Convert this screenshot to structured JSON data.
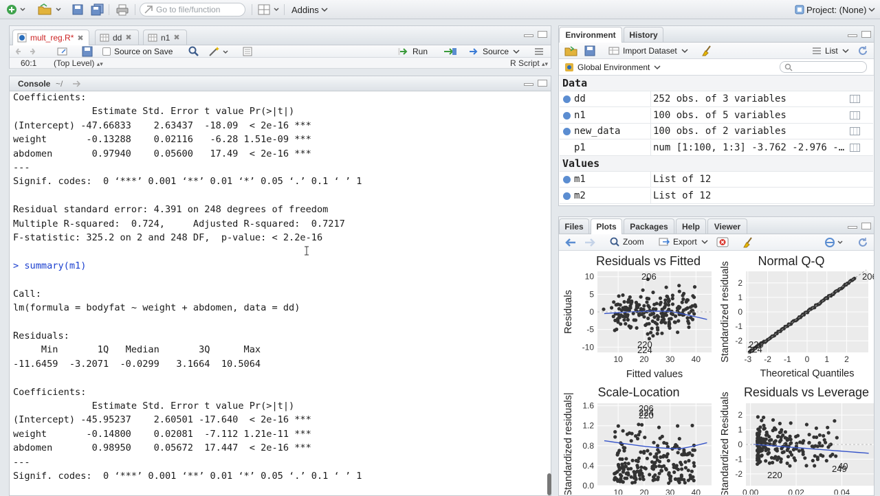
{
  "toolbar": {
    "goto_placeholder": "Go to file/function",
    "addins_label": "Addins",
    "project_label": "Project: (None)"
  },
  "source_pane": {
    "tabs": [
      {
        "label": "mult_reg.R*",
        "active": true
      },
      {
        "label": "dd",
        "active": false
      },
      {
        "label": "n1",
        "active": false
      }
    ],
    "source_on_save_label": "Source on Save",
    "run_label": "Run",
    "source_label": "Source",
    "cursor_pos": "60:1",
    "scope_label": "(Top Level)",
    "file_type": "R Script"
  },
  "console": {
    "title": "Console",
    "path": "~/",
    "lines": [
      {
        "text": "Coefficients:",
        "cmd": false
      },
      {
        "text": "              Estimate Std. Error t value Pr(>|t|)    ",
        "cmd": false
      },
      {
        "text": "(Intercept) -47.66833    2.63437  -18.09  < 2e-16 ***",
        "cmd": false
      },
      {
        "text": "weight       -0.13288    0.02116   -6.28 1.51e-09 ***",
        "cmd": false
      },
      {
        "text": "abdomen       0.97940    0.05600   17.49  < 2e-16 ***",
        "cmd": false
      },
      {
        "text": "---",
        "cmd": false
      },
      {
        "text": "Signif. codes:  0 ‘***’ 0.001 ‘**’ 0.01 ‘*’ 0.05 ‘.’ 0.1 ‘ ’ 1",
        "cmd": false
      },
      {
        "text": "",
        "cmd": false
      },
      {
        "text": "Residual standard error: 4.391 on 248 degrees of freedom",
        "cmd": false
      },
      {
        "text": "Multiple R-squared:  0.724,\tAdjusted R-squared:  0.7217 ",
        "cmd": false
      },
      {
        "text": "F-statistic: 325.2 on 2 and 248 DF,  p-value: < 2.2e-16",
        "cmd": false
      },
      {
        "text": "",
        "cmd": false
      },
      {
        "text": "> summary(m1)",
        "cmd": true
      },
      {
        "text": "",
        "cmd": false
      },
      {
        "text": "Call:",
        "cmd": false
      },
      {
        "text": "lm(formula = bodyfat ~ weight + abdomen, data = dd)",
        "cmd": false
      },
      {
        "text": "",
        "cmd": false
      },
      {
        "text": "Residuals:",
        "cmd": false
      },
      {
        "text": "     Min       1Q   Median       3Q      Max ",
        "cmd": false
      },
      {
        "text": "-11.6459  -3.2071  -0.0299   3.1664  10.5064 ",
        "cmd": false
      },
      {
        "text": "",
        "cmd": false
      },
      {
        "text": "Coefficients:",
        "cmd": false
      },
      {
        "text": "              Estimate Std. Error t value Pr(>|t|)    ",
        "cmd": false
      },
      {
        "text": "(Intercept) -45.95237    2.60501 -17.640  < 2e-16 ***",
        "cmd": false
      },
      {
        "text": "weight       -0.14800    0.02081  -7.112 1.21e-11 ***",
        "cmd": false
      },
      {
        "text": "abdomen       0.98950    0.05672  17.447  < 2e-16 ***",
        "cmd": false
      },
      {
        "text": "---",
        "cmd": false
      },
      {
        "text": "Signif. codes:  0 ‘***’ 0.001 ‘**’ 0.01 ‘*’ 0.05 ‘.’ 0.1 ‘ ’ 1",
        "cmd": false
      }
    ]
  },
  "env_pane": {
    "tabs": [
      {
        "label": "Environment",
        "active": true
      },
      {
        "label": "History",
        "active": false
      }
    ],
    "import_label": "Import Dataset",
    "list_label": "List",
    "scope_label": "Global Environment",
    "data_heading": "Data",
    "values_heading": "Values",
    "data": [
      {
        "name": "dd",
        "value": "252 obs. of 3 variables",
        "expand": true
      },
      {
        "name": "n1",
        "value": "100 obs. of 5 variables",
        "expand": true
      },
      {
        "name": "new_data",
        "value": "100 obs. of 2 variables",
        "expand": true
      },
      {
        "name": "p1",
        "value": "num [1:100, 1:3] -3.762 -2.976 -…",
        "expand": false
      }
    ],
    "values": [
      {
        "name": "m1",
        "value": "List of 12"
      },
      {
        "name": "m2",
        "value": "List of 12"
      }
    ]
  },
  "plots_pane": {
    "tabs": [
      {
        "label": "Files",
        "active": false
      },
      {
        "label": "Plots",
        "active": true
      },
      {
        "label": "Packages",
        "active": false
      },
      {
        "label": "Help",
        "active": false
      },
      {
        "label": "Viewer",
        "active": false
      }
    ],
    "zoom_label": "Zoom",
    "export_label": "Export"
  },
  "chart_data": [
    {
      "type": "scatter",
      "title": "Residuals vs Fitted",
      "xlabel": "Fitted values",
      "ylabel": "Residuals",
      "xlim": [
        2,
        46
      ],
      "ylim": [
        -11.5,
        11.5
      ],
      "xticks": [
        "10",
        "20",
        "30",
        "40"
      ],
      "yticks": [
        "10",
        "5",
        "0",
        "-5",
        "-10"
      ],
      "point_labels": [
        "206",
        "220",
        "224"
      ],
      "grid": true,
      "smooth_line": true
    },
    {
      "type": "scatter",
      "title": "Normal Q-Q",
      "xlabel": "Theoretical Quantiles",
      "ylabel": "Standardized residuals",
      "xlim": [
        -3.1,
        3.1
      ],
      "ylim": [
        -2.8,
        2.8
      ],
      "xticks": [
        "-3",
        "-2",
        "-1",
        "0",
        "1",
        "2"
      ],
      "yticks": [
        "2",
        "1",
        "0",
        "-1",
        "-2"
      ],
      "point_labels": [
        "206",
        "220",
        "224"
      ],
      "grid": true
    },
    {
      "type": "scatter",
      "title": "Scale-Location",
      "xlabel": "",
      "ylabel": "Standardized residuals|",
      "xlim": [
        2,
        46
      ],
      "ylim": [
        0,
        1.65
      ],
      "xticks": [
        "10",
        "20",
        "30",
        "40"
      ],
      "yticks": [
        "1.6",
        "1.2",
        "0.8",
        "0.4",
        "0.0"
      ],
      "point_labels": [
        "206",
        "224",
        "220"
      ],
      "grid": true,
      "smooth_line": true
    },
    {
      "type": "scatter",
      "title": "Residuals vs Leverage",
      "xlabel": "",
      "ylabel": "Standardized Residuals",
      "xlim": [
        -0.002,
        0.054
      ],
      "ylim": [
        -2.8,
        2.8
      ],
      "xticks": [
        "0.00",
        "0.02",
        "0.04"
      ],
      "yticks": [
        "2",
        "1",
        "0",
        "-1",
        "-2"
      ],
      "point_labels": [
        "220",
        "249",
        "40"
      ],
      "grid": true,
      "smooth_line": true
    }
  ]
}
